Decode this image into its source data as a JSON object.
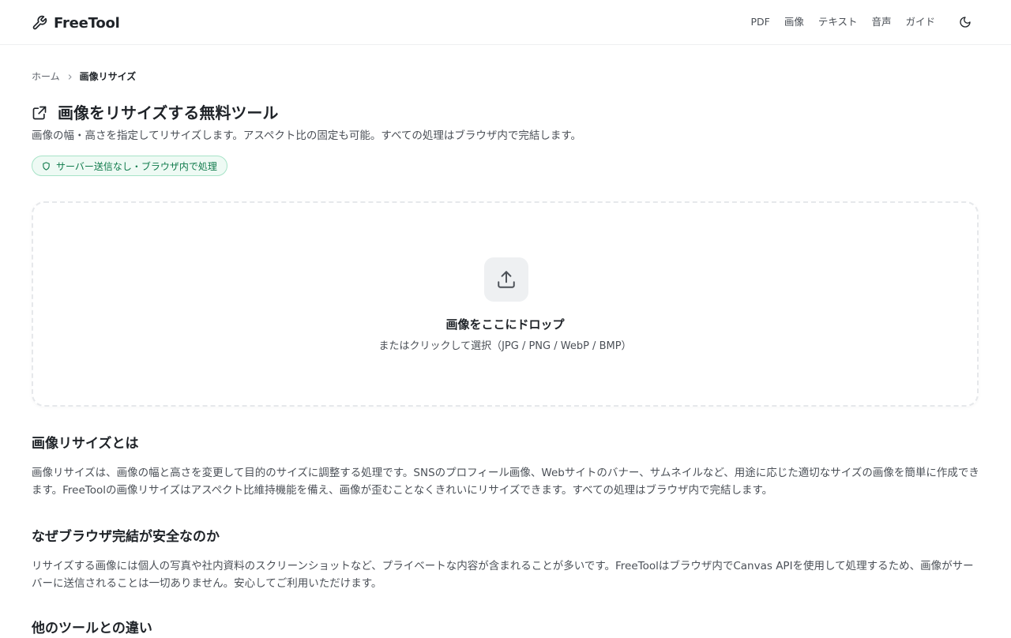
{
  "header": {
    "logo_text": "FreeTool",
    "nav": [
      "PDF",
      "画像",
      "テキスト",
      "音声",
      "ガイド"
    ]
  },
  "breadcrumb": {
    "home": "ホーム",
    "current": "画像リサイズ"
  },
  "page": {
    "title": "画像をリサイズする無料ツール",
    "description": "画像の幅・高さを指定してリサイズします。アスペクト比の固定も可能。すべての処理はブラウザ内で完結します。",
    "badge": "サーバー送信なし・ブラウザ内で処理"
  },
  "dropzone": {
    "title": "画像をここにドロップ",
    "subtitle": "またはクリックして選択（JPG / PNG / WebP / BMP）"
  },
  "sections": [
    {
      "title": "画像リサイズとは",
      "body": "画像リサイズは、画像の幅と高さを変更して目的のサイズに調整する処理です。SNSのプロフィール画像、Webサイトのバナー、サムネイルなど、用途に応じた適切なサイズの画像を簡単に作成できます。FreeToolの画像リサイズはアスペクト比維持機能を備え、画像が歪むことなくきれいにリサイズできます。すべての処理はブラウザ内で完結します。"
    },
    {
      "title": "なぜブラウザ完結が安全なのか",
      "body": "リサイズする画像には個人の写真や社内資料のスクリーンショットなど、プライベートな内容が含まれることが多いです。FreeToolはブラウザ内でCanvas APIを使用して処理するため、画像がサーバーに送信されることは一切ありません。安心してご利用いただけます。"
    },
    {
      "title": "他のツールとの違い"
    }
  ],
  "colors": {
    "badge_text": "#0e7a4a",
    "badge_bg": "#eefaf4",
    "badge_border": "#a7e3c7",
    "text_primary": "#1f2328",
    "text_secondary": "#4b5057"
  },
  "icons": {
    "logo": "wrench-icon",
    "theme_toggle": "moon-icon",
    "breadcrumb_separator": "chevron-right-icon",
    "title": "external-link-icon",
    "badge": "shield-icon",
    "upload": "upload-icon"
  }
}
